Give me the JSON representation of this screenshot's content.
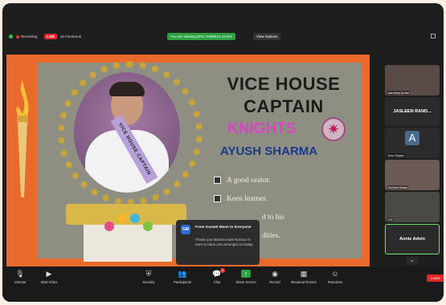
{
  "topbar": {
    "recording": "Recording",
    "live": "LIVE",
    "platform": "on Facebook",
    "viewing": "You are viewing DPS JAMMU's screen",
    "view_options": "View Options"
  },
  "slide": {
    "title_line1": "VICE HOUSE",
    "title_line2": "CAPTAIN",
    "house": "KNIGHTS",
    "name": "AYUSH SHARMA",
    "sash_text": "VICE HOUSE CAPTAIN",
    "bullets": [
      "A good orator.",
      "Keen learner.",
      "d to his",
      "dities."
    ]
  },
  "chat": {
    "avatar": "GM",
    "from": "From Guneet Mann to Everyone",
    "message": "Thank you Mamta mam-honour is ours to have you amongst us today."
  },
  "participants": [
    {
      "name": "sandeep jindal",
      "kind": "video"
    },
    {
      "name": "JASLEEN RAND...",
      "kind": "name"
    },
    {
      "name": "Anu Dogra",
      "kind": "letter",
      "letter": "A"
    },
    {
      "name": "Guneet Mann",
      "kind": "video"
    },
    {
      "name": "VG",
      "kind": "video"
    },
    {
      "name": "Annie Advin",
      "kind": "name",
      "active": true
    }
  ],
  "toolbar": {
    "unmute": "Unmute",
    "start_video": "Start Video",
    "security": "Security",
    "participants": "Participants",
    "participants_count": "45",
    "chat": "Chat",
    "chat_badge": "1",
    "share_screen": "Share Screen",
    "record": "Record",
    "breakout": "Breakout Rooms",
    "reactions": "Reactions",
    "leave": "Leave"
  },
  "colors": {
    "live": "#e0262b",
    "viewing_banner": "#2ea043",
    "slide_bg": "#e96a2c",
    "knights": "#d546c2",
    "name": "#1a3a8a",
    "leave": "#e02828"
  }
}
